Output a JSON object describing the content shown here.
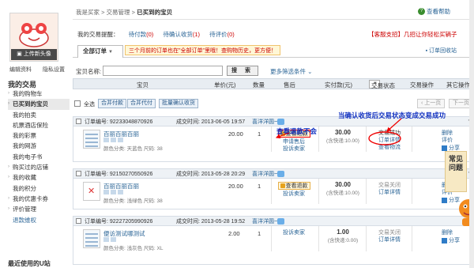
{
  "colors": {
    "accent_link": "#2a6496",
    "annotation_blue": "#1030c0",
    "alert_red": "#e00000",
    "header_bg": "#e8edf2"
  },
  "profile": {
    "upload_label": "上传新头像",
    "edit_profile": "编辑资料",
    "privacy": "隐私设置"
  },
  "sidebar": {
    "section_title": "我的交易",
    "items": [
      {
        "label": "我的购物车",
        "icon": "arrow-right-icon"
      },
      {
        "label": "已买到的宝贝",
        "icon": "arrow-right-icon"
      },
      {
        "label": "我的拍卖",
        "icon": ""
      },
      {
        "label": "机票酒店保险",
        "icon": ""
      },
      {
        "label": "我的彩票",
        "icon": ""
      },
      {
        "label": "我的网游",
        "icon": ""
      },
      {
        "label": "我的电子书",
        "icon": ""
      },
      {
        "label": "购买过的店铺",
        "icon": "arrow-right-icon"
      },
      {
        "label": "我的收藏",
        "icon": "arrow-right-icon"
      },
      {
        "label": "我的积分",
        "icon": ""
      },
      {
        "label": "我的优惠卡券",
        "icon": "arrow-right-icon"
      },
      {
        "label": "评价管理",
        "icon": "arrow-right-icon"
      },
      {
        "label": "退款维权",
        "icon": ""
      }
    ],
    "recent_apps_title": "最近使用的U站"
  },
  "breadcrumb": {
    "home": "我是买家",
    "sep1": " > ",
    "mid": "交易管理",
    "sep2": " > ",
    "current": "已买到的宝贝"
  },
  "help_label": "查看帮助",
  "reminders": {
    "title": "我的交易提醒：",
    "items": [
      {
        "label": "待付款",
        "count": "(0)"
      },
      {
        "label": "待确认收货",
        "count": "(1)"
      },
      {
        "label": "待评价",
        "count": "(0)"
      }
    ],
    "promo": "【客服支招】几招让你轻松买辆子"
  },
  "tabs": {
    "all_orders": "全部订单",
    "notice": "三个月前的订单也在\"全部订单\"里哦！查购物历史，更方便！",
    "recycle": "订单回收站"
  },
  "search": {
    "label": "宝贝名称:",
    "button": "搜 索",
    "more": "更多筛选条件"
  },
  "table_head": {
    "item": "宝贝",
    "unit_price": "单价(元)",
    "qty": "数量",
    "after_sale": "售后",
    "paid": "实付款(元)",
    "state_select": "交易状态",
    "trade_ops": "交易操作",
    "other_ops": "其它操作"
  },
  "toolbar": {
    "select_all": "全选",
    "merge_pay": "合并付款",
    "merge_proxy": "合并代付",
    "batch_confirm": "批量确认收货",
    "prev_page": "上一页",
    "next_page": "下一页"
  },
  "orders": [
    {
      "order_no": "订单编号: 92233048870926",
      "time": "成交时间: 2013-06-05 19:57",
      "seller": "喜洋洋圆一",
      "item_name": "百丽百丽百丽",
      "attrs": "颜色分类: 天蓝色  尺码: 38",
      "price": "20.00",
      "qty": "1",
      "after": [
        "查看退款",
        "申请售后",
        "投诉卖家"
      ],
      "paid": "30.00",
      "shipping": "(含快递:10.00)",
      "state": [
        "交易成功",
        "订单详情",
        "查看物流"
      ],
      "ops": [
        "删除",
        "评价",
        "分享"
      ]
    },
    {
      "order_no": "订单编号: 92150270550926",
      "time": "成交时间: 2013-05-28 20:29",
      "seller": "喜洋洋圆一",
      "item_name": "百丽百丽百丽",
      "attrs": "颜色分类: 浅绿色  尺码: 38",
      "price": "20.00",
      "qty": "1",
      "after": [
        "查看退款",
        "投诉卖家"
      ],
      "paid": "30.00",
      "shipping": "(含快递:10.00)",
      "state": [
        "交易关闭",
        "订单详情"
      ],
      "ops": [
        "删除",
        "评价",
        "分享"
      ]
    },
    {
      "order_no": "订单编号: 92227205990926",
      "time": "成交时间: 2013-05-28 19:52",
      "seller": "喜洋洋圆一",
      "item_name": "便访测试哪测试",
      "attrs": "颜色分类: 浅灰色  尺码: XL",
      "price": "2.00",
      "qty": "1",
      "after": [
        "投诉卖家"
      ],
      "paid": "1.00",
      "shipping": "(含快递:0.00)",
      "state": [
        "交易关闭",
        "订单详情"
      ],
      "ops": [
        "删除",
        "分享"
      ]
    }
  ],
  "annotations": {
    "view_refund": "查看退款不会",
    "status_change": "当确认收货后交易状态变成交易成功"
  },
  "faq": {
    "label": "常见问题"
  }
}
